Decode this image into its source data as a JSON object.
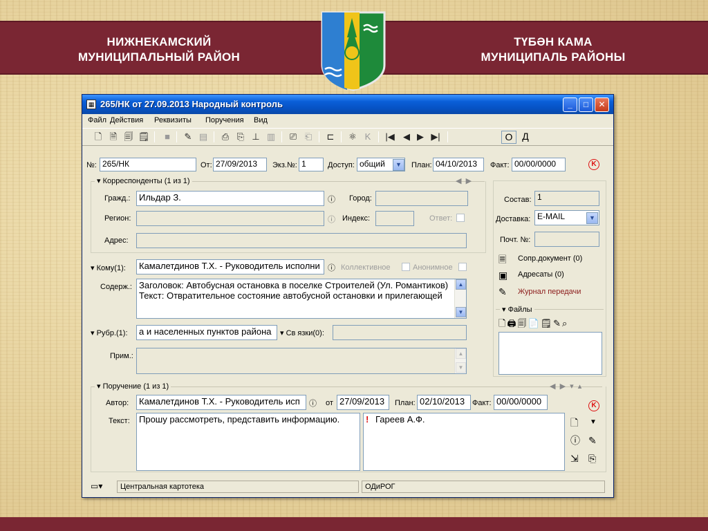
{
  "banner": {
    "left_line1": "НИЖНЕКАМСКИЙ",
    "left_line2": "МУНИЦИПАЛЬНЫЙ РАЙОН",
    "right_line1": "ТҮБӘН КАМА",
    "right_line2": "МУНИЦИПАЛЬ РАЙОНЫ",
    "colors": {
      "banner": "#7a2633",
      "crest_blue": "#2e7fd1",
      "crest_yellow": "#f0c419",
      "crest_green": "#1e8a3a"
    }
  },
  "window": {
    "title": "265/НК от 27.09.2013 Народный контроль",
    "icon": "document-icon",
    "controls": {
      "min": "_",
      "max": "□",
      "close": "✕"
    }
  },
  "menu": [
    "Файл",
    "Действия",
    "Реквизиты",
    "Поручения",
    "Вид"
  ],
  "toolbar": {
    "view_o": "О",
    "view_d": "Д"
  },
  "header": {
    "num_label": "№:",
    "num_value": "265/НК",
    "from_label": "От:",
    "from_value": "27/09/2013",
    "copy_label": "Экз.№:",
    "copy_value": "1",
    "access_label": "Доступ:",
    "access_value": "общий",
    "plan_label": "План:",
    "plan_value": "04/10/2013",
    "fact_label": "Факт:",
    "fact_value": "00/00/0000"
  },
  "correspondents": {
    "title": "Корреспонденты (1 из 1)",
    "citizen_label": "Гражд.:",
    "citizen_value": "Ильдар З.",
    "city_label": "Город:",
    "city_value": "",
    "region_label": "Регион:",
    "region_value": "",
    "index_label": "Индекс:",
    "index_value": "",
    "answer_label": "Ответ:",
    "address_label": "Адрес:",
    "address_value": ""
  },
  "right_panel": {
    "composition_label": "Состав:",
    "composition_value": "1",
    "delivery_label": "Доставка:",
    "delivery_value": "E-MAIL",
    "postal_label": "Почт. №:",
    "postal_value": "",
    "links": [
      "Сопр.документ (0)",
      "Адресаты (0)",
      "Журнал передачи"
    ],
    "files_title": "Файлы"
  },
  "addressee": {
    "to_label": "Кому(1):",
    "to_value": "Камалетдинов Т.Х. - Руководитель исполни",
    "collective_label": "Коллективное",
    "anonymous_label": "Анонимное",
    "content_label": "Содерж.:",
    "content_value": "Заголовок: Автобусная остановка в поселке Строителей (Ул. Романтиков)\nТекст: Отвратительное состояние автобусной остановки и прилегающей",
    "rubric_label": "Рубр.(1):",
    "rubric_value": "а и населенных пунктов района",
    "links_label": "Св язки(0):",
    "links_value": "",
    "note_label": "Прим.:",
    "note_value": ""
  },
  "assignment": {
    "title": "Поручение (1 из 1)",
    "author_label": "Автор:",
    "author_value": "Камалетдинов Т.Х. - Руководитель исп",
    "from_label": "от",
    "from_value": "27/09/2013",
    "plan_label": "План:",
    "plan_value": "02/10/2013",
    "fact_label": "Факт:",
    "fact_value": "00/00/0000",
    "text_label": "Текст:",
    "text_value": "Прошу рассмотреть, представить информацию.",
    "executor_mark": "!",
    "executor_value": "Гареев А.Ф."
  },
  "statusbar": {
    "left": "Центральная картотека",
    "right": "ОДиРОГ"
  }
}
